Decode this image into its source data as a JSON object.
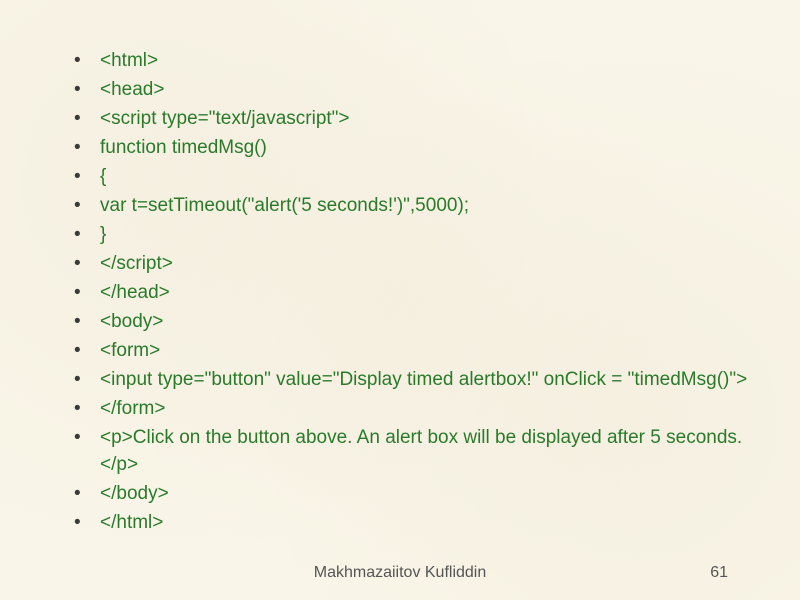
{
  "code_lines": [
    "<html>",
    "<head>",
    "<script type=\"text/javascript\">",
    "function timedMsg()",
    "{",
    "var t=setTimeout(\"alert('5 seconds!')\",5000);",
    "}",
    "</script>",
    "</head>",
    "<body>",
    "<form>",
    "<input type=\"button\" value=\"Display timed alertbox!\" onClick = \"timedMsg()\">",
    "</form>",
    "<p>Click on the button above. An alert box will be displayed after 5 seconds.</p>",
    "</body>",
    "</html>"
  ],
  "footer": {
    "author": "Makhmazaiitov Kufliddin",
    "page": "61"
  }
}
